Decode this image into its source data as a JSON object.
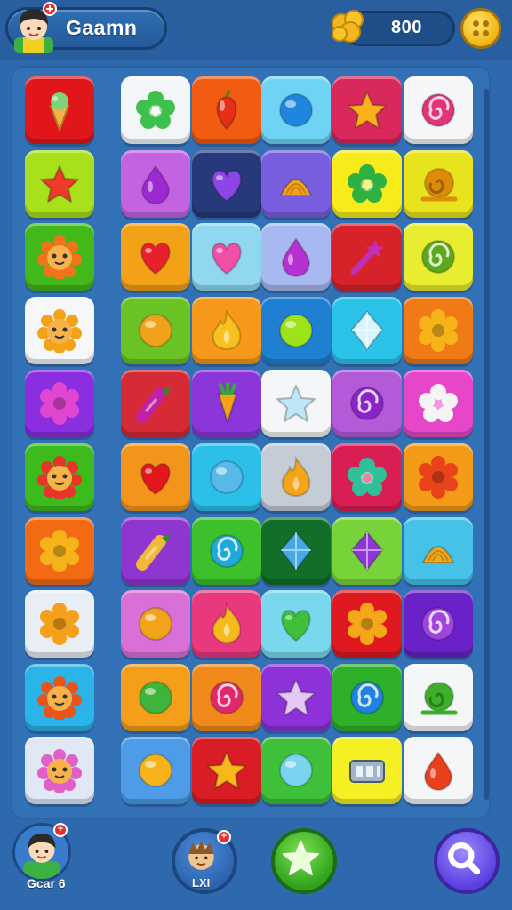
{
  "header": {
    "player_name": "Gaamn",
    "coins": "800"
  },
  "footer": {
    "player_label": "Gcar 6",
    "friend_label": "LXI"
  },
  "colors": {
    "background": "#2f69ad",
    "coin": "#f4b61e",
    "play": "#3dbb24",
    "search": "#5b3fe0"
  },
  "board": {
    "rows": [
      [
        {
          "bg": "#e0161b",
          "icon": "ice-cream-icon",
          "color": "#f2b14a"
        },
        {
          "bg": "#f3f6f8",
          "icon": "flower-icon",
          "color": "#3fc04c"
        },
        {
          "bg": "#f25b12",
          "icon": "pepper-icon",
          "color": "#e62f18"
        },
        {
          "bg": "#6fd4f3",
          "icon": "ball-icon",
          "color": "#1f86e0"
        },
        {
          "bg": "#d8285c",
          "icon": "star-icon",
          "color": "#f9b21b"
        },
        {
          "bg": "#f4f6f8",
          "icon": "swirl-icon",
          "color": "#e0357a"
        }
      ],
      [
        {
          "bg": "#a8e01c",
          "icon": "star-icon",
          "color": "#ef3a2a"
        },
        {
          "bg": "#c363e0",
          "icon": "drop-icon",
          "color": "#9c2ad0"
        },
        {
          "bg": "#27397a",
          "icon": "heart-icon",
          "color": "#8c45e6"
        },
        {
          "bg": "#7a5ee0",
          "icon": "shell-icon",
          "color": "#f5a21b"
        },
        {
          "bg": "#f7ec1a",
          "icon": "flower-icon",
          "color": "#2eb043"
        },
        {
          "bg": "#e7e31c",
          "icon": "snail-icon",
          "color": "#e08a0a"
        }
      ],
      [
        {
          "bg": "#43b81a",
          "icon": "lion-icon",
          "color": "#f2741a"
        },
        {
          "bg": "#f3a116",
          "icon": "heart-icon",
          "color": "#e8202a"
        },
        {
          "bg": "#8fd8f0",
          "icon": "heart-icon",
          "color": "#ef4fa6"
        },
        {
          "bg": "#a8b8f0",
          "icon": "drop-icon",
          "color": "#b631d0"
        },
        {
          "bg": "#d8222a",
          "icon": "wand-icon",
          "color": "#c02fb4"
        },
        {
          "bg": "#e8ed30",
          "icon": "swirl-icon",
          "color": "#5ea81c"
        }
      ],
      [
        {
          "bg": "#f5f7f9",
          "icon": "lion-icon",
          "color": "#f4a218"
        },
        {
          "bg": "#6ac224",
          "icon": "ball-icon",
          "color": "#f2a11a"
        },
        {
          "bg": "#f6981a",
          "icon": "flame-icon",
          "color": "#f8c21e"
        },
        {
          "bg": "#1f7fd0",
          "icon": "ball-icon",
          "color": "#9ee21a"
        },
        {
          "bg": "#2bc4e8",
          "icon": "diamond-icon",
          "color": "#d8f4ff"
        },
        {
          "bg": "#f07a16",
          "icon": "donut-icon",
          "color": "#f7b418"
        }
      ],
      [
        {
          "bg": "#8a2ee0",
          "icon": "donut-icon",
          "color": "#e046d0"
        },
        {
          "bg": "#d62a36",
          "icon": "candy-icon",
          "color": "#c022a4"
        },
        {
          "bg": "#8b36d8",
          "icon": "carrot-icon",
          "color": "#f5a41a"
        },
        {
          "bg": "#f4f6f8",
          "icon": "star-icon",
          "color": "#bfe6f6"
        },
        {
          "bg": "#b25ad8",
          "icon": "swirl-icon",
          "color": "#8a24c8"
        },
        {
          "bg": "#e646c8",
          "icon": "flower-icon",
          "color": "#f4f4f4"
        }
      ],
      [
        {
          "bg": "#3dba1c",
          "icon": "lion-icon",
          "color": "#e8342a"
        },
        {
          "bg": "#f3951a",
          "icon": "heart-icon",
          "color": "#e3181e"
        },
        {
          "bg": "#2cbfe8",
          "icon": "ball-icon",
          "color": "#58b8e8"
        },
        {
          "bg": "#c4ccd6",
          "icon": "flame-icon",
          "color": "#f4a418"
        },
        {
          "bg": "#d81e52",
          "icon": "flower-icon",
          "color": "#2fc09a"
        },
        {
          "bg": "#f39a16",
          "icon": "donut-icon",
          "color": "#e8431a"
        }
      ],
      [
        {
          "bg": "#f26a14",
          "icon": "donut-icon",
          "color": "#f6b41a"
        },
        {
          "bg": "#9036d0",
          "icon": "candy-icon",
          "color": "#f2b838"
        },
        {
          "bg": "#3dc02c",
          "icon": "swirl-icon",
          "color": "#20a8d8"
        },
        {
          "bg": "#126f2a",
          "icon": "diamond-icon",
          "color": "#45a8e8"
        },
        {
          "bg": "#78d23a",
          "icon": "diamond-icon",
          "color": "#8f36d8"
        },
        {
          "bg": "#46c2e8",
          "icon": "shell-icon",
          "color": "#f2a81e"
        }
      ],
      [
        {
          "bg": "#e8eef4",
          "icon": "donut-icon",
          "color": "#f5a01a"
        },
        {
          "bg": "#d870d8",
          "icon": "ball-icon",
          "color": "#f2a31a"
        },
        {
          "bg": "#e8387e",
          "icon": "flame-icon",
          "color": "#f7ba1c"
        },
        {
          "bg": "#7ad8ec",
          "icon": "heart-icon",
          "color": "#3fbf3a"
        },
        {
          "bg": "#e01820",
          "icon": "donut-icon",
          "color": "#f4a718"
        },
        {
          "bg": "#6a22c8",
          "icon": "swirl-icon",
          "color": "#a044e0"
        }
      ],
      [
        {
          "bg": "#2ab4e8",
          "icon": "lion-icon",
          "color": "#e8541a"
        },
        {
          "bg": "#f49e1a",
          "icon": "ball-icon",
          "color": "#3fb43a"
        },
        {
          "bg": "#f08a1a",
          "icon": "swirl-icon",
          "color": "#e0286a"
        },
        {
          "bg": "#8c32d8",
          "icon": "star-icon",
          "color": "#e4c8f4"
        },
        {
          "bg": "#2fb02a",
          "icon": "swirl-icon",
          "color": "#1f82e0"
        },
        {
          "bg": "#f4f6f8",
          "icon": "snail-icon",
          "color": "#3cb02a"
        }
      ],
      [
        {
          "bg": "#dfe8f4",
          "icon": "lion-icon",
          "color": "#e060c8"
        },
        {
          "bg": "#4e9ce8",
          "icon": "ball-icon",
          "color": "#f6b41a"
        },
        {
          "bg": "#d81e24",
          "icon": "star-icon",
          "color": "#f7b81c"
        },
        {
          "bg": "#3fc03a",
          "icon": "ball-icon",
          "color": "#7ad4f0"
        },
        {
          "bg": "#f4f024",
          "icon": "box-icon",
          "color": "#9fb4c8"
        },
        {
          "bg": "#f4f6f8",
          "icon": "drop-icon",
          "color": "#e8401c"
        }
      ]
    ]
  }
}
